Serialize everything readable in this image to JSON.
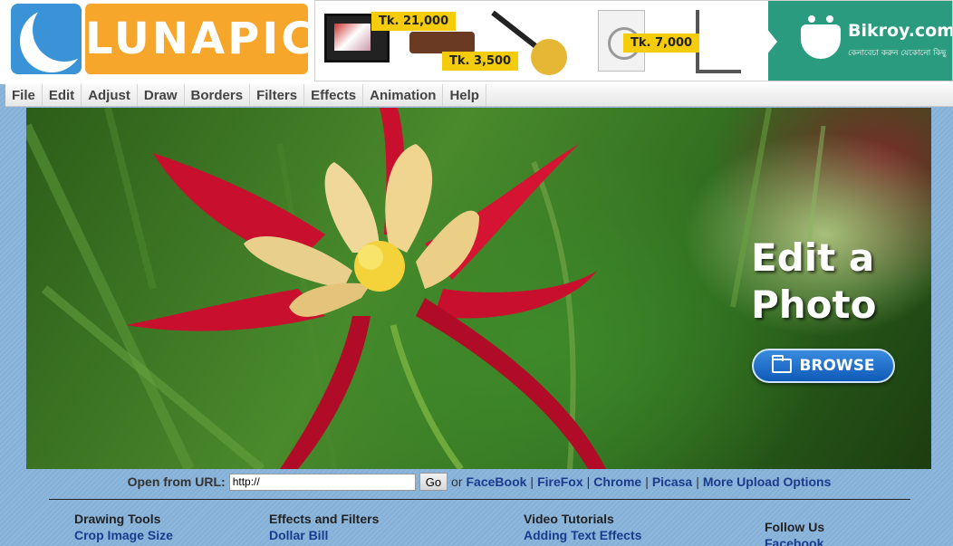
{
  "logo": {
    "text": "LUNAPIC"
  },
  "ad": {
    "prices": [
      "Tk. 21,000",
      "Tk. 3,500",
      "Tk. 7,000"
    ],
    "brand_name": "Bikroy.com",
    "brand_tagline": "কেনাবেচা করুন যেকোনো কিছু"
  },
  "menu": [
    "File",
    "Edit",
    "Adjust",
    "Draw",
    "Borders",
    "Filters",
    "Effects",
    "Animation",
    "Help"
  ],
  "hero": {
    "title_line1": "Edit a",
    "title_line2": "Photo",
    "browse_label": "BROWSE"
  },
  "url_row": {
    "label": "Open from URL:",
    "input_value": "http://",
    "go_label": "Go",
    "or_text": "or",
    "links": [
      "FaceBook",
      "FireFox",
      "Chrome",
      "Picasa",
      "More Upload Options"
    ]
  },
  "footer": {
    "col1": {
      "heading": "Drawing Tools",
      "link": "Crop Image Size"
    },
    "col2": {
      "heading": "Effects and Filters",
      "link": "Dollar Bill"
    },
    "col3": {
      "heading": "Video Tutorials",
      "link": "Adding Text Effects"
    },
    "col4": {
      "heading": "Follow Us",
      "link": "Facebook"
    }
  },
  "colors": {
    "page_background": "#8ab4da",
    "logo_blue": "#3a93d6",
    "logo_orange": "#f6a62a",
    "brand_green": "#2a9b7e",
    "link_blue": "#1a3b8c",
    "browse_blue": "#1565c0"
  },
  "icons": [
    "moon-logo-icon",
    "folder-icon",
    "smiley-brand-icon"
  ]
}
